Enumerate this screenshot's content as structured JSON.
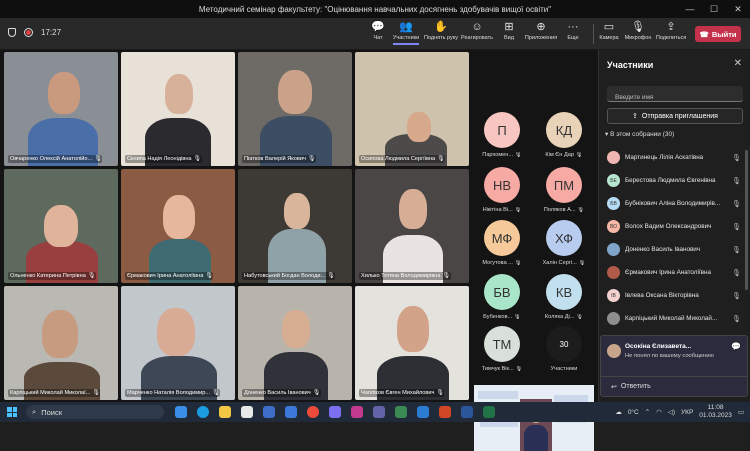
{
  "window": {
    "title": "Методичний семінар факультету: \"Оцінювання навчальних досягнень здобувачів вищої освіти\""
  },
  "meeting": {
    "timer": "17:27"
  },
  "toolbar": {
    "chat": "Чат",
    "participants": "Участники",
    "raise_hand": "Поднять руку",
    "react": "Реагировать",
    "view": "Вид",
    "apps": "Приложения",
    "more": "Еще",
    "camera": "Камера",
    "mic": "Микрофон",
    "share": "Поделиться",
    "leave": "Выйти",
    "colors": {
      "leave": "#c4314b",
      "accent": "#7f85f5"
    }
  },
  "tiles": [
    {
      "name": "Овчаренко Олексій Анатолійо..."
    },
    {
      "name": "Скнипа Надія Леонідівна"
    },
    {
      "name": "Піатков Валерій Якович"
    },
    {
      "name": "Осипова Людмила Сергіївна"
    },
    {
      "name": "Ольненко Катерина Петрівна"
    },
    {
      "name": "Єрмакович Ірина Анатоліївна"
    },
    {
      "name": "Набутовський Богдан Володи..."
    },
    {
      "name": "Хилько Тетяна Володимирівна"
    },
    {
      "name": "Карпіцький Миколай Миколаї..."
    },
    {
      "name": "Марченко Наталія Володимир..."
    },
    {
      "name": "Доненко Василь Іванович"
    },
    {
      "name": "Чапліков Євген Михайлович"
    }
  ],
  "avatars": [
    {
      "initials": "П",
      "name": "Пархомен...",
      "color": "#f7c6c0"
    },
    {
      "initials": "КД",
      "name": "Кім Єн Дар",
      "color": "#e8d2b8"
    },
    {
      "initials": "НВ",
      "name": "Нікітіна Ві...",
      "color": "#f7a9a3"
    },
    {
      "initials": "ПМ",
      "name": "Поляков А...",
      "color": "#f7a9a3"
    },
    {
      "initials": "МФ",
      "name": "Могутова ...",
      "color": "#f5c99a"
    },
    {
      "initials": "ХФ",
      "name": "Халін Сергі...",
      "color": "#b8ccf0"
    },
    {
      "initials": "БВ",
      "name": "Бубенков...",
      "color": "#a9e6c9"
    },
    {
      "initials": "КВ",
      "name": "Коляка Ді...",
      "color": "#c2dff0"
    },
    {
      "initials": "ТМ",
      "name": "Тимчук Вік...",
      "color": "#d9e0da"
    },
    {
      "initials": "30",
      "name": "Участники",
      "color": "#1c1c1c"
    }
  ],
  "panel": {
    "title": "Участники",
    "search_placeholder": "Введите имя",
    "invite": "Отправка приглашения",
    "section": "В этом собрании (30)",
    "people": [
      {
        "name": "Мартинець Лілія Аскатівна",
        "color": "#f0b7b2",
        "initials": ""
      },
      {
        "name": "Берестова Людмила Євгенівна",
        "color": "#b6e5d0",
        "initials": "БЕ"
      },
      {
        "name": "Бубнікович Аліна Володимирів...",
        "color": "#b6dcf5",
        "initials": "БВ"
      },
      {
        "name": "Волох Вадим Олександрович",
        "color": "#f7b8a8",
        "initials": "ВО"
      },
      {
        "name": "Доненко Василь Іванович",
        "color": "#7fa6c9",
        "initials": ""
      },
      {
        "name": "Єрмакович Ірина Анатоліївна",
        "color": "#b05a4a",
        "initials": ""
      },
      {
        "name": "Івлева Оксана Вікторівна",
        "color": "#f2d2d0",
        "initials": "ІВ"
      },
      {
        "name": "Карпіцький Миколай Миколай...",
        "color": "#8e8e8e",
        "initials": ""
      }
    ]
  },
  "chat_popup": {
    "name": "Осокіна Єлизавета...",
    "message": "Не понял по вашему сообщению",
    "reply": "Ответить"
  },
  "taskbar": {
    "search": "Поиск",
    "weather": "0°C",
    "lang": "УКР",
    "time": "11:08",
    "date": "01.03.2023"
  }
}
